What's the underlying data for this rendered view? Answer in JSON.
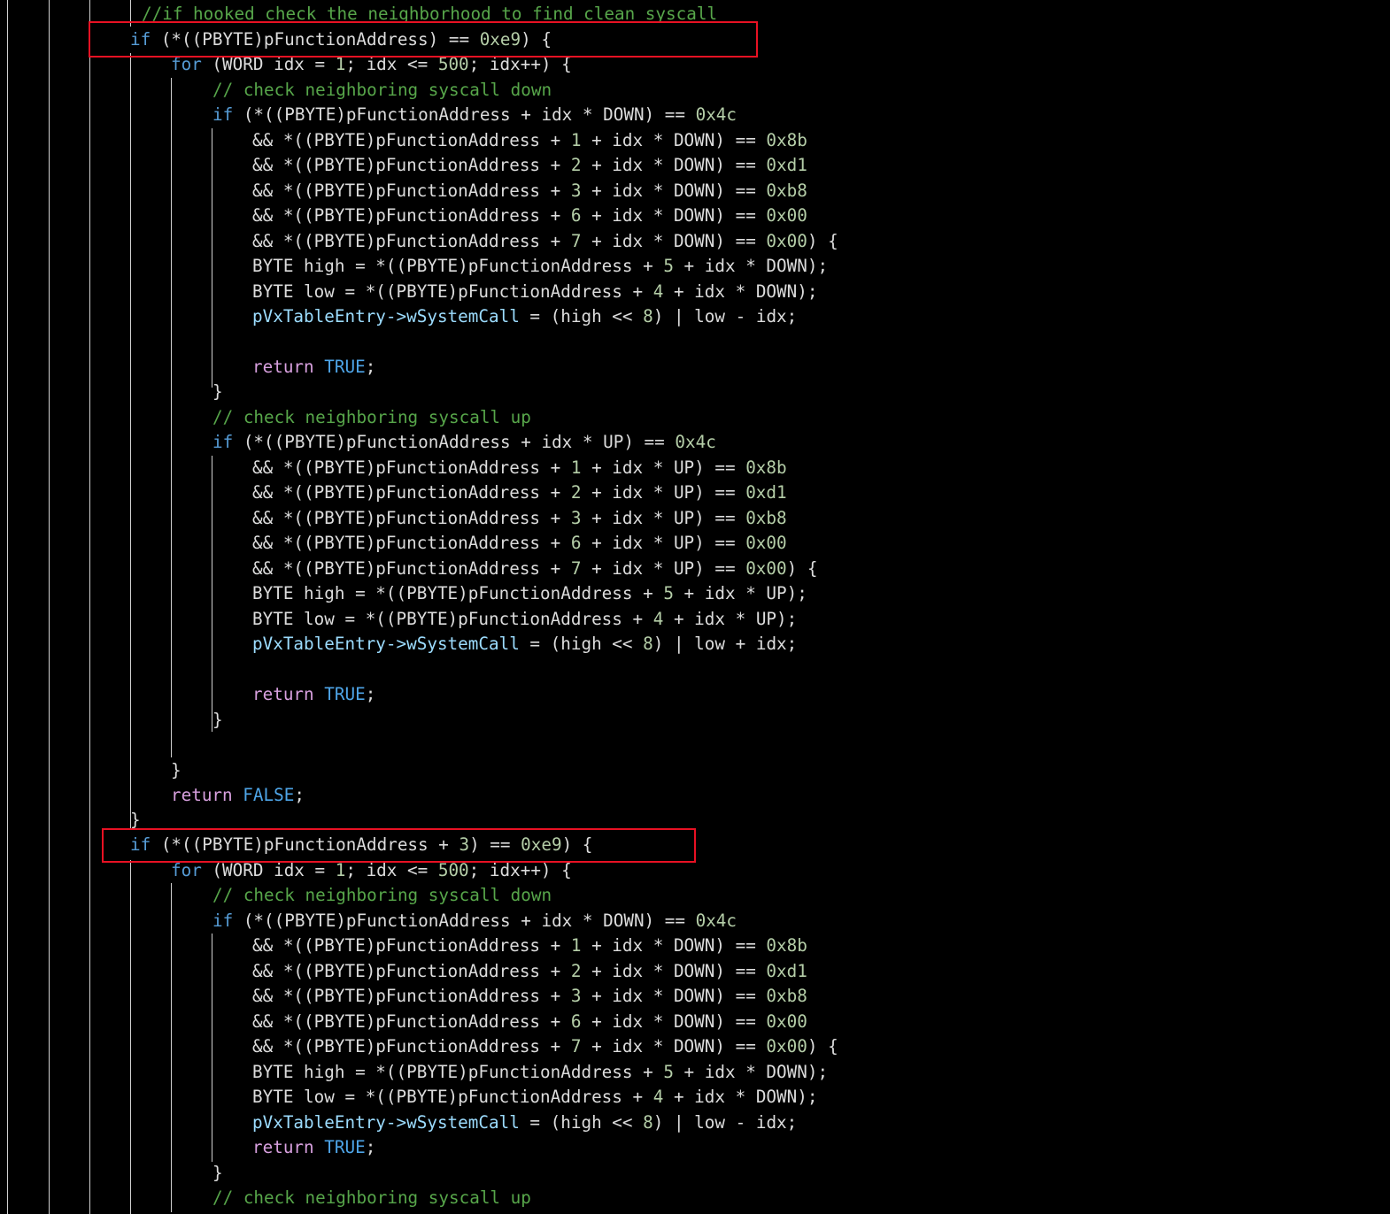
{
  "editor": {
    "theme": {
      "background": "#000000",
      "text": "#dcdcdc",
      "keyword": "#569cd6",
      "control": "#d8a0df",
      "comment": "#57a64a",
      "number": "#b5cea8",
      "field": "#9cdcfe",
      "highlight_box": "#e81123"
    },
    "lines": [
      {
        "tokens": [
          {
            "t": "//if hooked check the neighborhood to find clean syscall",
            "c": "cm"
          }
        ]
      },
      {
        "tokens": [
          {
            "t": "if",
            "c": "kw"
          },
          {
            "t": " (*((PBYTE)pFunctionAddress) == ",
            "c": "tx"
          },
          {
            "t": "0xe9",
            "c": "num"
          },
          {
            "t": ") {",
            "c": "tx"
          }
        ]
      },
      {
        "tokens": [
          {
            "t": "for",
            "c": "kw"
          },
          {
            "t": " (WORD idx = ",
            "c": "tx"
          },
          {
            "t": "1",
            "c": "num"
          },
          {
            "t": "; idx <= ",
            "c": "tx"
          },
          {
            "t": "500",
            "c": "num"
          },
          {
            "t": "; idx++) {",
            "c": "tx"
          }
        ]
      },
      {
        "tokens": [
          {
            "t": "// check neighboring syscall down",
            "c": "cm"
          }
        ]
      },
      {
        "tokens": [
          {
            "t": "if",
            "c": "kw"
          },
          {
            "t": " (*((PBYTE)pFunctionAddress + idx * DOWN) == ",
            "c": "tx"
          },
          {
            "t": "0x4c",
            "c": "num"
          }
        ]
      },
      {
        "tokens": [
          {
            "t": "&& *((PBYTE)pFunctionAddress + ",
            "c": "tx"
          },
          {
            "t": "1",
            "c": "num"
          },
          {
            "t": " + idx * DOWN) == ",
            "c": "tx"
          },
          {
            "t": "0x8b",
            "c": "num"
          }
        ]
      },
      {
        "tokens": [
          {
            "t": "&& *((PBYTE)pFunctionAddress + ",
            "c": "tx"
          },
          {
            "t": "2",
            "c": "num"
          },
          {
            "t": " + idx * DOWN) == ",
            "c": "tx"
          },
          {
            "t": "0xd1",
            "c": "num"
          }
        ]
      },
      {
        "tokens": [
          {
            "t": "&& *((PBYTE)pFunctionAddress + ",
            "c": "tx"
          },
          {
            "t": "3",
            "c": "num"
          },
          {
            "t": " + idx * DOWN) == ",
            "c": "tx"
          },
          {
            "t": "0xb8",
            "c": "num"
          }
        ]
      },
      {
        "tokens": [
          {
            "t": "&& *((PBYTE)pFunctionAddress + ",
            "c": "tx"
          },
          {
            "t": "6",
            "c": "num"
          },
          {
            "t": " + idx * DOWN) == ",
            "c": "tx"
          },
          {
            "t": "0x00",
            "c": "num"
          }
        ]
      },
      {
        "tokens": [
          {
            "t": "&& *((PBYTE)pFunctionAddress + ",
            "c": "tx"
          },
          {
            "t": "7",
            "c": "num"
          },
          {
            "t": " + idx * DOWN) == ",
            "c": "tx"
          },
          {
            "t": "0x00",
            "c": "num"
          },
          {
            "t": ") {",
            "c": "tx"
          }
        ]
      },
      {
        "tokens": [
          {
            "t": "BYTE high = *((PBYTE)pFunctionAddress + ",
            "c": "tx"
          },
          {
            "t": "5",
            "c": "num"
          },
          {
            "t": " + idx * DOWN);",
            "c": "tx"
          }
        ]
      },
      {
        "tokens": [
          {
            "t": "BYTE low = *((PBYTE)pFunctionAddress + ",
            "c": "tx"
          },
          {
            "t": "4",
            "c": "num"
          },
          {
            "t": " + idx * DOWN);",
            "c": "tx"
          }
        ]
      },
      {
        "tokens": [
          {
            "t": "pVxTableEntry->",
            "c": "fld"
          },
          {
            "t": "wSystemCall",
            "c": "fld"
          },
          {
            "t": " = (high << ",
            "c": "tx"
          },
          {
            "t": "8",
            "c": "num"
          },
          {
            "t": ") | low - idx;",
            "c": "tx"
          }
        ]
      },
      {
        "tokens": []
      },
      {
        "tokens": [
          {
            "t": "return",
            "c": "ctl"
          },
          {
            "t": " ",
            "c": "tx"
          },
          {
            "t": "TRUE",
            "c": "mac"
          },
          {
            "t": ";",
            "c": "tx"
          }
        ]
      },
      {
        "tokens": [
          {
            "t": "}",
            "c": "tx"
          }
        ]
      },
      {
        "tokens": [
          {
            "t": "// check neighboring syscall up",
            "c": "cm"
          }
        ]
      },
      {
        "tokens": [
          {
            "t": "if",
            "c": "kw"
          },
          {
            "t": " (*((PBYTE)pFunctionAddress + idx * UP) == ",
            "c": "tx"
          },
          {
            "t": "0x4c",
            "c": "num"
          }
        ]
      },
      {
        "tokens": [
          {
            "t": "&& *((PBYTE)pFunctionAddress + ",
            "c": "tx"
          },
          {
            "t": "1",
            "c": "num"
          },
          {
            "t": " + idx * UP) == ",
            "c": "tx"
          },
          {
            "t": "0x8b",
            "c": "num"
          }
        ]
      },
      {
        "tokens": [
          {
            "t": "&& *((PBYTE)pFunctionAddress + ",
            "c": "tx"
          },
          {
            "t": "2",
            "c": "num"
          },
          {
            "t": " + idx * UP) == ",
            "c": "tx"
          },
          {
            "t": "0xd1",
            "c": "num"
          }
        ]
      },
      {
        "tokens": [
          {
            "t": "&& *((PBYTE)pFunctionAddress + ",
            "c": "tx"
          },
          {
            "t": "3",
            "c": "num"
          },
          {
            "t": " + idx * UP) == ",
            "c": "tx"
          },
          {
            "t": "0xb8",
            "c": "num"
          }
        ]
      },
      {
        "tokens": [
          {
            "t": "&& *((PBYTE)pFunctionAddress + ",
            "c": "tx"
          },
          {
            "t": "6",
            "c": "num"
          },
          {
            "t": " + idx * UP) == ",
            "c": "tx"
          },
          {
            "t": "0x00",
            "c": "num"
          }
        ]
      },
      {
        "tokens": [
          {
            "t": "&& *((PBYTE)pFunctionAddress + ",
            "c": "tx"
          },
          {
            "t": "7",
            "c": "num"
          },
          {
            "t": " + idx * UP) == ",
            "c": "tx"
          },
          {
            "t": "0x00",
            "c": "num"
          },
          {
            "t": ") {",
            "c": "tx"
          }
        ]
      },
      {
        "tokens": [
          {
            "t": "BYTE high = *((PBYTE)pFunctionAddress + ",
            "c": "tx"
          },
          {
            "t": "5",
            "c": "num"
          },
          {
            "t": " + idx * UP);",
            "c": "tx"
          }
        ]
      },
      {
        "tokens": [
          {
            "t": "BYTE low = *((PBYTE)pFunctionAddress + ",
            "c": "tx"
          },
          {
            "t": "4",
            "c": "num"
          },
          {
            "t": " + idx * UP);",
            "c": "tx"
          }
        ]
      },
      {
        "tokens": [
          {
            "t": "pVxTableEntry->",
            "c": "fld"
          },
          {
            "t": "wSystemCall",
            "c": "fld"
          },
          {
            "t": " = (high << ",
            "c": "tx"
          },
          {
            "t": "8",
            "c": "num"
          },
          {
            "t": ") | low + idx;",
            "c": "tx"
          }
        ]
      },
      {
        "tokens": []
      },
      {
        "tokens": [
          {
            "t": "return",
            "c": "ctl"
          },
          {
            "t": " ",
            "c": "tx"
          },
          {
            "t": "TRUE",
            "c": "mac"
          },
          {
            "t": ";",
            "c": "tx"
          }
        ]
      },
      {
        "tokens": [
          {
            "t": "}",
            "c": "tx"
          }
        ]
      },
      {
        "tokens": []
      },
      {
        "tokens": [
          {
            "t": "}",
            "c": "tx"
          }
        ]
      },
      {
        "tokens": [
          {
            "t": "return",
            "c": "ctl"
          },
          {
            "t": " ",
            "c": "tx"
          },
          {
            "t": "FALSE",
            "c": "mac"
          },
          {
            "t": ";",
            "c": "tx"
          }
        ]
      },
      {
        "tokens": [
          {
            "t": "}",
            "c": "tx"
          }
        ]
      },
      {
        "tokens": [
          {
            "t": "if",
            "c": "kw"
          },
          {
            "t": " (*((PBYTE)pFunctionAddress + ",
            "c": "tx"
          },
          {
            "t": "3",
            "c": "num"
          },
          {
            "t": ") == ",
            "c": "tx"
          },
          {
            "t": "0xe9",
            "c": "num"
          },
          {
            "t": ") {",
            "c": "tx"
          }
        ]
      },
      {
        "tokens": [
          {
            "t": "for",
            "c": "kw"
          },
          {
            "t": " (WORD idx = ",
            "c": "tx"
          },
          {
            "t": "1",
            "c": "num"
          },
          {
            "t": "; idx <= ",
            "c": "tx"
          },
          {
            "t": "500",
            "c": "num"
          },
          {
            "t": "; idx++) {",
            "c": "tx"
          }
        ]
      },
      {
        "tokens": [
          {
            "t": "// check neighboring syscall down",
            "c": "cm"
          }
        ]
      },
      {
        "tokens": [
          {
            "t": "if",
            "c": "kw"
          },
          {
            "t": " (*((PBYTE)pFunctionAddress + idx * DOWN) == ",
            "c": "tx"
          },
          {
            "t": "0x4c",
            "c": "num"
          }
        ]
      },
      {
        "tokens": [
          {
            "t": "&& *((PBYTE)pFunctionAddress + ",
            "c": "tx"
          },
          {
            "t": "1",
            "c": "num"
          },
          {
            "t": " + idx * DOWN) == ",
            "c": "tx"
          },
          {
            "t": "0x8b",
            "c": "num"
          }
        ]
      },
      {
        "tokens": [
          {
            "t": "&& *((PBYTE)pFunctionAddress + ",
            "c": "tx"
          },
          {
            "t": "2",
            "c": "num"
          },
          {
            "t": " + idx * DOWN) == ",
            "c": "tx"
          },
          {
            "t": "0xd1",
            "c": "num"
          }
        ]
      },
      {
        "tokens": [
          {
            "t": "&& *((PBYTE)pFunctionAddress + ",
            "c": "tx"
          },
          {
            "t": "3",
            "c": "num"
          },
          {
            "t": " + idx * DOWN) == ",
            "c": "tx"
          },
          {
            "t": "0xb8",
            "c": "num"
          }
        ]
      },
      {
        "tokens": [
          {
            "t": "&& *((PBYTE)pFunctionAddress + ",
            "c": "tx"
          },
          {
            "t": "6",
            "c": "num"
          },
          {
            "t": " + idx * DOWN) == ",
            "c": "tx"
          },
          {
            "t": "0x00",
            "c": "num"
          }
        ]
      },
      {
        "tokens": [
          {
            "t": "&& *((PBYTE)pFunctionAddress + ",
            "c": "tx"
          },
          {
            "t": "7",
            "c": "num"
          },
          {
            "t": " + idx * DOWN) == ",
            "c": "tx"
          },
          {
            "t": "0x00",
            "c": "num"
          },
          {
            "t": ") {",
            "c": "tx"
          }
        ]
      },
      {
        "tokens": [
          {
            "t": "BYTE high = *((PBYTE)pFunctionAddress + ",
            "c": "tx"
          },
          {
            "t": "5",
            "c": "num"
          },
          {
            "t": " + idx * DOWN);",
            "c": "tx"
          }
        ]
      },
      {
        "tokens": [
          {
            "t": "BYTE low = *((PBYTE)pFunctionAddress + ",
            "c": "tx"
          },
          {
            "t": "4",
            "c": "num"
          },
          {
            "t": " + idx * DOWN);",
            "c": "tx"
          }
        ]
      },
      {
        "tokens": [
          {
            "t": "pVxTableEntry->",
            "c": "fld"
          },
          {
            "t": "wSystemCall",
            "c": "fld"
          },
          {
            "t": " = (high << ",
            "c": "tx"
          },
          {
            "t": "8",
            "c": "num"
          },
          {
            "t": ") | low - idx;",
            "c": "tx"
          }
        ]
      },
      {
        "tokens": [
          {
            "t": "return",
            "c": "ctl"
          },
          {
            "t": " ",
            "c": "tx"
          },
          {
            "t": "TRUE",
            "c": "mac"
          },
          {
            "t": ";",
            "c": "tx"
          }
        ]
      },
      {
        "tokens": [
          {
            "t": "}",
            "c": "tx"
          }
        ]
      },
      {
        "tokens": [
          {
            "t": "// check neighboring syscall up",
            "c": "cm"
          }
        ]
      }
    ]
  }
}
